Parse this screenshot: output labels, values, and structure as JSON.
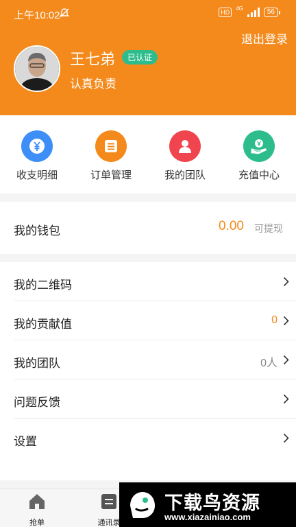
{
  "status_bar": {
    "time": "上午10:02",
    "network_badge": "HD",
    "network_type": "4G",
    "battery": "56"
  },
  "header": {
    "logout_label": "退出登录",
    "username": "王七弟",
    "verified_badge": "已认证",
    "motto": "认真负责",
    "background_color": "#f48a1c"
  },
  "quick_actions": [
    {
      "label": "收支明细",
      "icon": "yen-coin-icon",
      "color": "#3d8ef6"
    },
    {
      "label": "订单管理",
      "icon": "document-icon",
      "color": "#f48a1c"
    },
    {
      "label": "我的团队",
      "icon": "person-icon",
      "color": "#f0444e"
    },
    {
      "label": "充值中心",
      "icon": "hand-coin-icon",
      "color": "#2dbd8c"
    }
  ],
  "wallet": {
    "title": "我的钱包",
    "amount": "0.00",
    "note": "可提现"
  },
  "menu": [
    {
      "label": "我的二维码",
      "value": ""
    },
    {
      "label": "我的贡献值",
      "value": "0"
    },
    {
      "label": "我的团队",
      "value": "0人"
    },
    {
      "label": "问题反馈",
      "value": ""
    },
    {
      "label": "设置",
      "value": ""
    }
  ],
  "tabbar": {
    "tabs": [
      {
        "label": "抢单",
        "icon": "home-icon"
      },
      {
        "label": "通讯录",
        "icon": "contacts-icon"
      }
    ]
  },
  "watermark": {
    "title": "下载鸟资源",
    "url": "www.xiazainiao.com"
  },
  "colors": {
    "accent": "#f48a1c",
    "green": "#2dbd8c"
  }
}
